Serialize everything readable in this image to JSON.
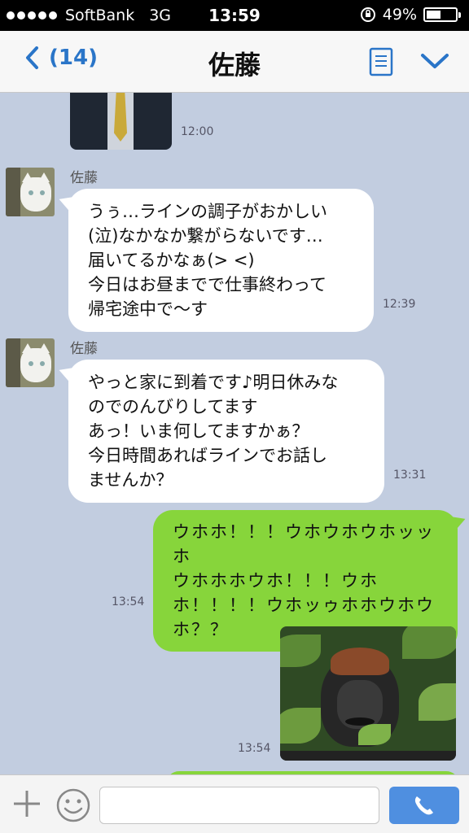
{
  "status_bar": {
    "signal_bars": 5,
    "carrier": "SoftBank",
    "network": "3G",
    "time": "13:59",
    "battery_percent_text": "49%",
    "battery_level": 0.49
  },
  "header": {
    "back_count": "(14)",
    "title": "佐藤"
  },
  "messages": [
    {
      "type": "image",
      "direction": "in",
      "time": "12:00",
      "image": "photo-suit-and-tie"
    },
    {
      "type": "text",
      "direction": "in",
      "sender": "佐藤",
      "time": "12:39",
      "text": "うぅ…ラインの調子がおかしい\n(泣)なかなか繋がらないです…\n届いてるかなぁ(> <)\n今日はお昼までで仕事終わって\n帰宅途中で〜す"
    },
    {
      "type": "text",
      "direction": "in",
      "sender": "佐藤",
      "time": "13:31",
      "text": "やっと家に到着です♪明日休みな\nのでのんびりしてます\nあっ！いま何してますかぁ？\n今日時間あればラインでお話し\nませんか？"
    },
    {
      "type": "text",
      "direction": "out",
      "time": "13:54",
      "text": "ウホホ！！！ウホウホウホッッホ\nウホホホウホ！！！ウホ\nホ！！！！ウホッゥホホウホウ\nホ？？"
    },
    {
      "type": "image",
      "direction": "out",
      "time": "13:54",
      "image": "photo-gorilla"
    }
  ],
  "input_bar": {
    "message_value": "",
    "icons": [
      "plus-icon",
      "smiley-icon",
      "phone-icon"
    ]
  },
  "colors": {
    "accent": "#2a75c8",
    "chat_background": "#c2cde0",
    "outgoing_bubble": "#87d53b",
    "incoming_bubble": "#ffffff",
    "call_button": "#4f8fe0"
  }
}
